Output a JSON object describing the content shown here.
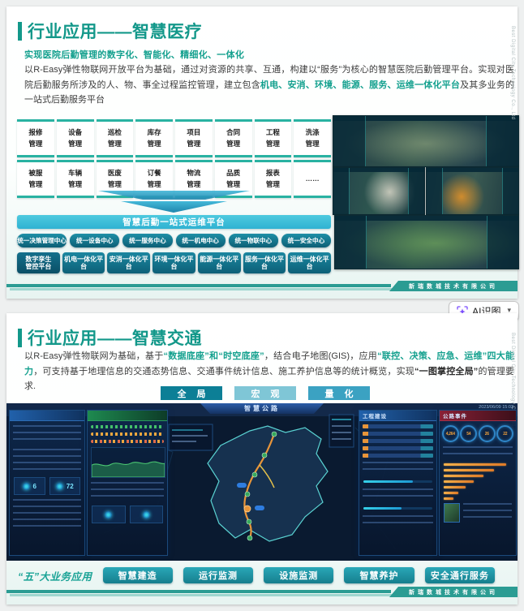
{
  "watermark": "Best Digital City Technology Co., Ltd",
  "footer_company": "新瑞数城技术有限公司",
  "ai_button": {
    "label": "AI识图"
  },
  "slide1": {
    "title": "行业应用——智慧医疗",
    "subtitle": "实现医院后勤管理的数字化、智能化、精细化、一体化",
    "para": [
      "以R-Easy弹性物联网开放平台为基础，通过对资源的共享、互通，构建以“服务”为核心的智慧医院后勤管理平台。实现对医院后勤服务所涉及的人、物、事全过程监控管理，建立包含",
      "机电、安消、环境、能源、服务、运维一体化平台",
      "及其多业务的一站式后勤服务平台"
    ],
    "modules": [
      "报修管理",
      "设备管理",
      "巡检管理",
      "库存管理",
      "项目管理",
      "合同管理",
      "工程管理",
      "洗涤管理",
      "被服管理",
      "车辆管理",
      "医废管理",
      "订餐管理",
      "物流管理",
      "品质管理",
      "报表管理",
      "……"
    ],
    "banner": "智慧后勤一站式运维平台",
    "centers": [
      "统一决策管理中心",
      "统一设备中心",
      "统一服务中心",
      "统一机电中心",
      "统一物联中心",
      "统一安全中心"
    ],
    "platforms": [
      "数字孪生管控平台",
      "机电一体化平台",
      "安消一体化平台",
      "环境一体化平台",
      "能源一体化平台",
      "服务一体化平台",
      "运维一体化平台"
    ]
  },
  "slide2": {
    "title": "行业应用——智慧交通",
    "para": [
      "以R-Easy弹性物联网为基础，基于",
      "“数据底座”和“时空底座”",
      "，结合电子地图(GIS)，应用",
      "“联控、决策、应急、运维”四大能力",
      "，可支持基于地理信息的交通态势信息、交通事件统计信息、施工养护信息等的统计概览，实现",
      "“一图掌控全局”",
      "的管理要求."
    ],
    "view_buttons": [
      "全 局",
      "宏 观",
      "量 化"
    ],
    "dashboard": {
      "title": "智慧公路",
      "timestamp": "2023/06/09 15:03",
      "panel_construction": "工程建设",
      "panel_events": "公路事件",
      "left_stats": [
        "6",
        "72"
      ],
      "gauges": [
        "4,264",
        "54",
        "26",
        "22"
      ]
    },
    "biz_label": "“五”大业务应用",
    "biz_buttons": [
      "智慧建造",
      "运行监测",
      "设施监测",
      "智慧养护",
      "安全通行服务"
    ]
  }
}
